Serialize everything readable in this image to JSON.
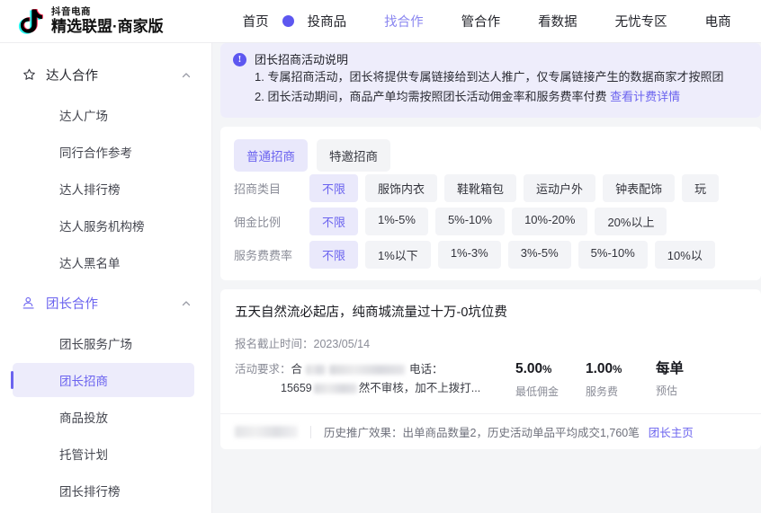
{
  "brand": {
    "logo_icon": "tiktok-note-icon",
    "small_text": "抖音电商",
    "big_text": "精选联盟·商家版"
  },
  "nav": {
    "items": [
      {
        "label": "首页",
        "active": false
      },
      {
        "label": "投商品",
        "active": false
      },
      {
        "label": "找合作",
        "active": true
      },
      {
        "label": "管合作",
        "active": false
      },
      {
        "label": "看数据",
        "active": false
      },
      {
        "label": "无忧专区",
        "active": false
      },
      {
        "label": "电商",
        "active": false
      }
    ],
    "dot_color": "#5d57f0"
  },
  "sidebar": {
    "groups": [
      {
        "label": "达人合作",
        "icon": "star-outline-icon",
        "active": false,
        "items": [
          {
            "label": "达人广场",
            "selected": false
          },
          {
            "label": "同行合作参考",
            "selected": false
          },
          {
            "label": "达人排行榜",
            "selected": false
          },
          {
            "label": "达人服务机构榜",
            "selected": false
          },
          {
            "label": "达人黑名单",
            "selected": false
          }
        ]
      },
      {
        "label": "团长合作",
        "icon": "user-group-icon",
        "active": true,
        "items": [
          {
            "label": "团长服务广场",
            "selected": false
          },
          {
            "label": "团长招商",
            "selected": true
          },
          {
            "label": "商品投放",
            "selected": false
          },
          {
            "label": "托管计划",
            "selected": false
          },
          {
            "label": "团长排行榜",
            "selected": false
          }
        ]
      }
    ]
  },
  "banner": {
    "icon": "info-circle-icon",
    "title": "团长招商活动说明",
    "line1": "1. 专属招商活动，团长将提供专属链接给到达人推广，仅专属链接产生的数据商家才按照团",
    "line2": "2. 团长活动期间，商品产单均需按照团长活动佣金率和服务费率付费",
    "link": "查看计费详情"
  },
  "tabs": [
    {
      "label": "普通招商",
      "active": true
    },
    {
      "label": "特邀招商",
      "active": false
    }
  ],
  "filters": [
    {
      "label": "招商类目",
      "chips": [
        {
          "label": "不限",
          "active": true
        },
        {
          "label": "服饰内衣",
          "active": false
        },
        {
          "label": "鞋靴箱包",
          "active": false
        },
        {
          "label": "运动户外",
          "active": false
        },
        {
          "label": "钟表配饰",
          "active": false
        },
        {
          "label": "玩",
          "active": false
        }
      ]
    },
    {
      "label": "佣金比例",
      "chips": [
        {
          "label": "不限",
          "active": true
        },
        {
          "label": "1%-5%",
          "active": false
        },
        {
          "label": "5%-10%",
          "active": false
        },
        {
          "label": "10%-20%",
          "active": false
        },
        {
          "label": "20%以上",
          "active": false
        }
      ]
    },
    {
      "label": "服务费费率",
      "chips": [
        {
          "label": "不限",
          "active": true
        },
        {
          "label": "1%以下",
          "active": false
        },
        {
          "label": "1%-3%",
          "active": false
        },
        {
          "label": "3%-5%",
          "active": false
        },
        {
          "label": "5%-10%",
          "active": false
        },
        {
          "label": "10%以",
          "active": false
        }
      ]
    }
  ],
  "campaign": {
    "title": "五天自然流必起店，纯商城流量过十万-0坑位费",
    "deadline_label": "报名截止时间：",
    "deadline_value": "2023/05/14",
    "req_label": "活动要求：",
    "req_text_1": "合",
    "req_text_2": "电话：",
    "req_text_3": "15659",
    "req_text_4": "然不审核，加不上拨打...",
    "stats": [
      {
        "value": "5.00",
        "unit": "%",
        "label": "最低佣金"
      },
      {
        "value": "1.00",
        "unit": "%",
        "label": "服务费"
      },
      {
        "value": "每单",
        "unit": "",
        "label": "预估"
      }
    ],
    "footer_text": "历史推广效果：出单商品数量2，历史活动单品平均成交1,760笔",
    "footer_link": "团长主页"
  }
}
